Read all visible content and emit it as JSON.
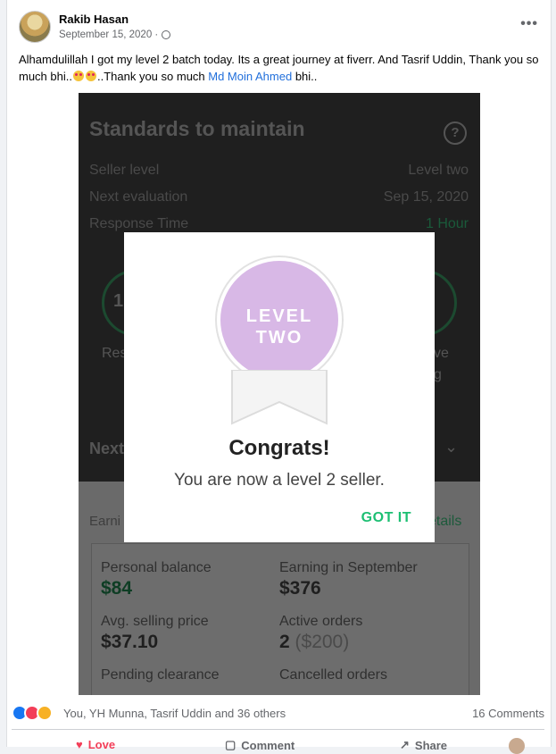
{
  "post": {
    "author": "Rakib Hasan",
    "date": "September 15, 2020 ·",
    "text_before": "Alhamdulillah I got my level 2 batch today. Its a great journey at fiverr. And Tasrif Uddin,  Thank you so much bhi..",
    "text_mid": "..Thank you so much ",
    "mention": "Md Moin Ahmed",
    "text_after": " bhi.."
  },
  "image": {
    "title": "Standards to maintain",
    "help": "?",
    "rows": [
      {
        "label": "Seller level",
        "value": "Level two"
      },
      {
        "label": "Next evaluation",
        "value": "Sep 15, 2020"
      },
      {
        "label": "Response Time",
        "value": "1 Hour"
      }
    ],
    "circle_left_value": "1",
    "circle_left_label": "Res",
    "circle_right_label_1": "ve",
    "circle_right_label_2": "g",
    "next_label": "Next",
    "earnings_label": "Earni",
    "details_label": "etails",
    "stats": [
      {
        "label": "Personal balance",
        "value": "$84"
      },
      {
        "label": "Earning in September",
        "value": "$376"
      },
      {
        "label": "Avg. selling price",
        "value": "$37.10"
      },
      {
        "label": "Active orders",
        "value": "2",
        "value_extra": "($200)"
      },
      {
        "label": "Pending clearance"
      },
      {
        "label": "Cancelled orders"
      }
    ]
  },
  "dialog": {
    "badge_line1": "LEVEL",
    "badge_line2": "TWO",
    "title": "Congrats!",
    "subtitle": "You are now a level 2 seller.",
    "button": "GOT IT"
  },
  "footer": {
    "reactions_text": "You, YH Munna, Tasrif Uddin and 36 others",
    "comments": "16 Comments",
    "love": "Love",
    "comment": "Comment",
    "share": "Share"
  },
  "colors": {
    "fiverr_green": "#1dbf73",
    "mention_blue": "#216fdb",
    "badge_purple": "#d8b8e6"
  }
}
